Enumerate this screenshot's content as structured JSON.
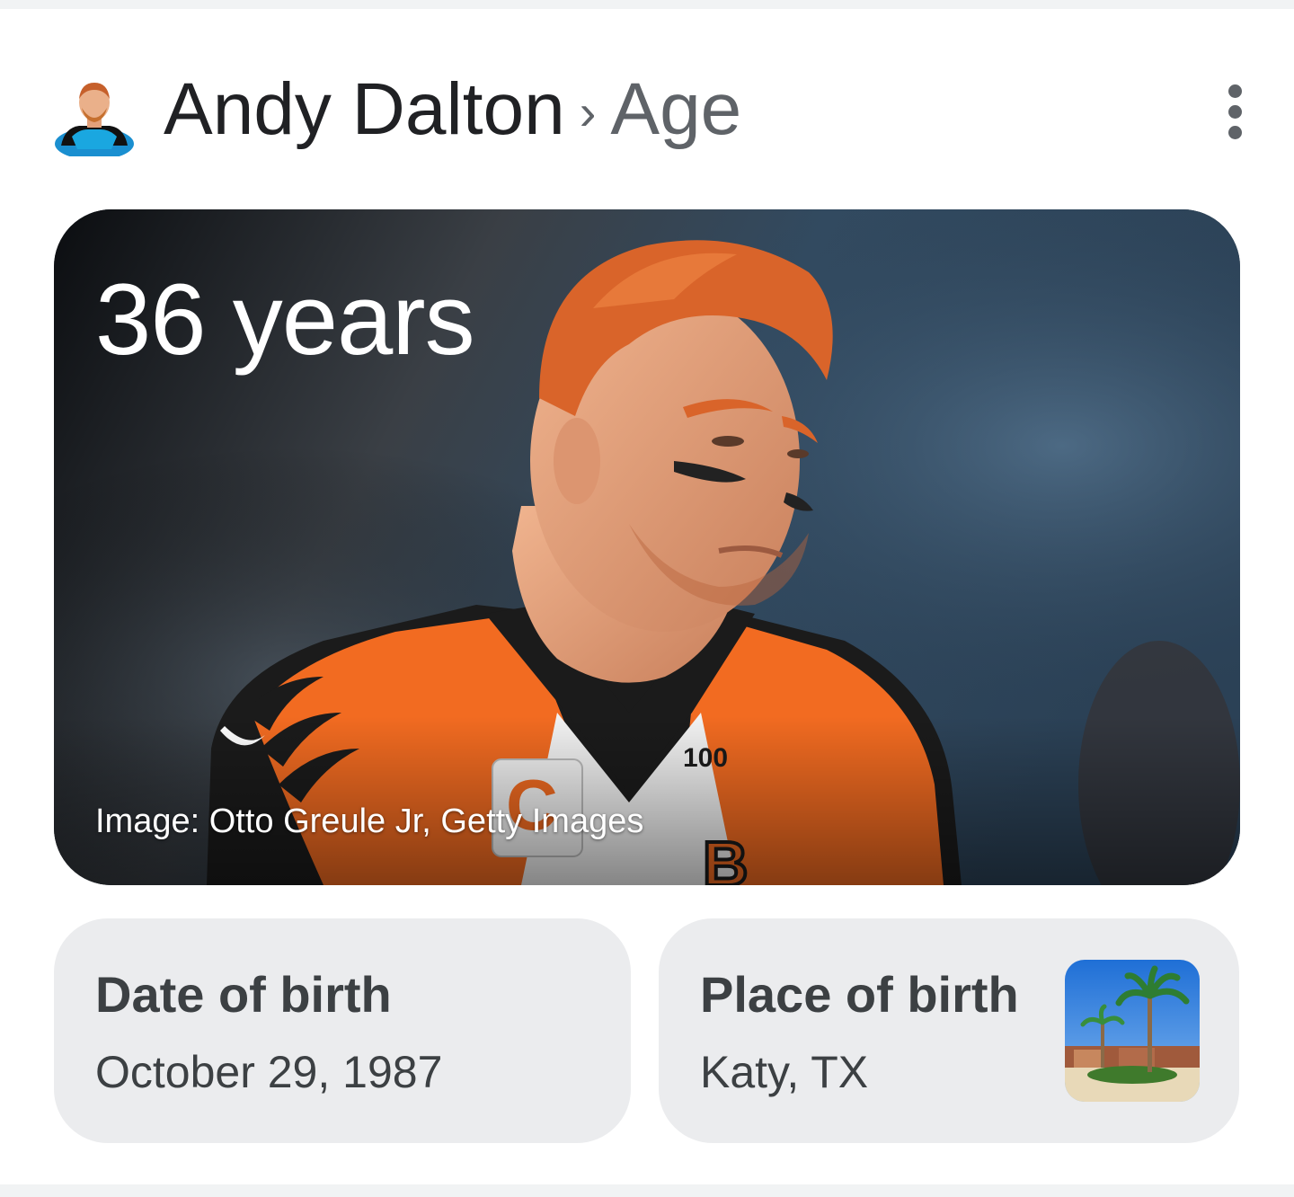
{
  "header": {
    "entity": "Andy Dalton",
    "separator": "›",
    "attribute": "Age",
    "more_icon": "more-vert-icon"
  },
  "hero": {
    "age": "36 years",
    "credit": "Image: Otto Greule Jr, Getty Images",
    "colors": {
      "hair": "#d9642a",
      "jersey_orange": "#f26b21",
      "jersey_black": "#1b1b1b",
      "background": "#2e4357"
    }
  },
  "facts": [
    {
      "label": "Date of birth",
      "value": "October 29, 1987"
    },
    {
      "label": "Place of birth",
      "value": "Katy, TX"
    }
  ]
}
